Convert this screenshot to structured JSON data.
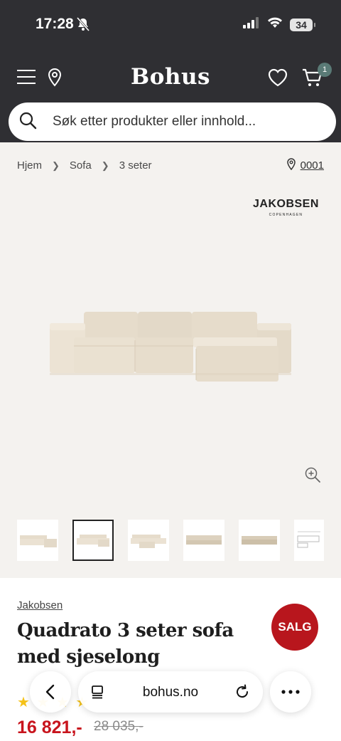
{
  "status_bar": {
    "time": "17:28",
    "battery": "34"
  },
  "header": {
    "logo": "Bohus",
    "cart_count": "1"
  },
  "search": {
    "placeholder": "Søk etter produkter eller innhold..."
  },
  "breadcrumb": {
    "items": [
      "Hjem",
      "Sofa",
      "3 seter"
    ]
  },
  "store": {
    "code": "0001"
  },
  "brand_logo": {
    "name": "JAKOBSEN",
    "sub": "COPENHAGEN"
  },
  "product": {
    "brand": "Jakobsen",
    "title": "Quadrato 3 seter sofa med sjeselong",
    "sale_badge": "SALG",
    "price": "16 821,-",
    "old_price": "28 035,-",
    "rating_stars": "★ ★ ★ ★"
  },
  "thumbnails": {
    "count": 6,
    "active_index": 1
  },
  "browser": {
    "url": "bohus.no"
  },
  "colors": {
    "header_bg": "#2f2f33",
    "sale_red": "#b8161d",
    "price_red": "#c8141d",
    "badge_teal": "#5a7a76",
    "page_bg": "#f4f2ef"
  },
  "icons": [
    "bell-muted-icon",
    "signal-icon",
    "wifi-icon",
    "battery-icon",
    "menu-icon",
    "location-pin-icon",
    "heart-icon",
    "cart-icon",
    "search-icon",
    "chevron-right-icon",
    "zoom-in-icon",
    "back-arrow-icon",
    "tabs-icon",
    "reload-icon",
    "more-icon"
  ]
}
